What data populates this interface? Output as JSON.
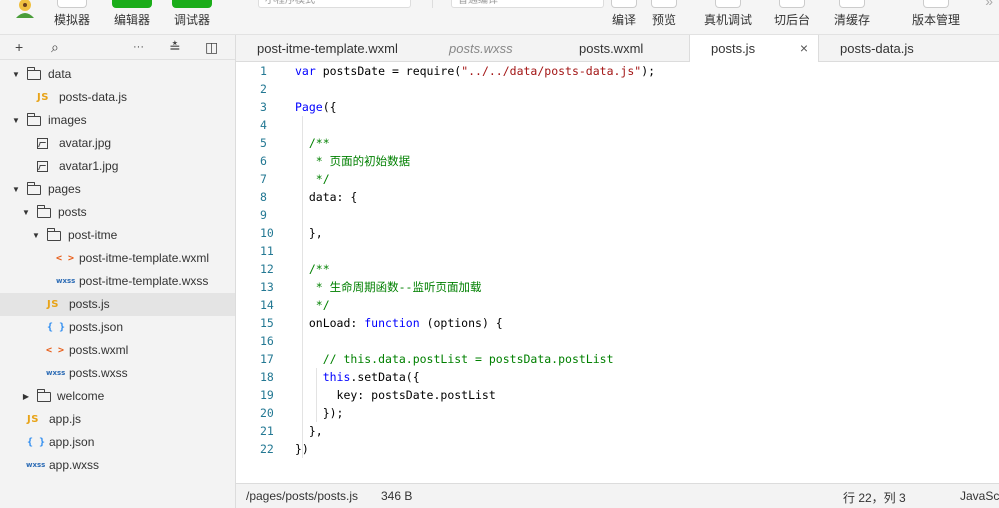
{
  "toolbar": {
    "buttons": [
      {
        "label": "模拟器"
      },
      {
        "label": "编辑器"
      },
      {
        "label": "调试器"
      },
      {
        "label": "编译"
      },
      {
        "label": "预览"
      },
      {
        "label": "真机调试"
      },
      {
        "label": "切后台"
      },
      {
        "label": "清缓存"
      },
      {
        "label": "版本管理"
      }
    ],
    "mode_select": "小程序模式",
    "compile_select": "普通编译"
  },
  "sidebar": {
    "tools": [
      "+",
      "⌕",
      "···",
      "≛",
      "◫"
    ],
    "tree": [
      {
        "label": "data",
        "type": "folder",
        "open": true
      },
      {
        "label": "posts-data.js",
        "type": "js"
      },
      {
        "label": "images",
        "type": "folder",
        "open": true
      },
      {
        "label": "avatar.jpg",
        "type": "image"
      },
      {
        "label": "avatar1.jpg",
        "type": "image"
      },
      {
        "label": "pages",
        "type": "folder",
        "open": true
      },
      {
        "label": "posts",
        "type": "folder",
        "open": true
      },
      {
        "label": "post-itme",
        "type": "folder",
        "open": true
      },
      {
        "label": "post-itme-template.wxml",
        "type": "wxml"
      },
      {
        "label": "post-itme-template.wxss",
        "type": "wxss"
      },
      {
        "label": "posts.js",
        "type": "js"
      },
      {
        "label": "posts.json",
        "type": "json"
      },
      {
        "label": "posts.wxml",
        "type": "wxml"
      },
      {
        "label": "posts.wxss",
        "type": "wxss"
      },
      {
        "label": "welcome",
        "type": "folder",
        "open": false
      },
      {
        "label": "app.js",
        "type": "js"
      },
      {
        "label": "app.json",
        "type": "json"
      },
      {
        "label": "app.wxss",
        "type": "wxss"
      }
    ],
    "icons": {
      "js": "JS",
      "json": "{ }",
      "wxml": "< >",
      "wxss": "wxss"
    }
  },
  "tabs": [
    {
      "label": "post-itme-template.wxml"
    },
    {
      "label": "posts.wxss"
    },
    {
      "label": "posts.wxml"
    },
    {
      "label": "posts.js",
      "close": "×"
    },
    {
      "label": "posts-data.js"
    }
  ],
  "editor": {
    "line_numbers": [
      "1",
      "2",
      "3",
      "4",
      "5",
      "6",
      "7",
      "8",
      "9",
      "10",
      "11",
      "12",
      "13",
      "14",
      "15",
      "16",
      "17",
      "18",
      "19",
      "20",
      "21",
      "22"
    ],
    "lines": [
      [
        {
          "t": "var",
          "c": "k"
        },
        {
          "t": " postsDate = require("
        },
        {
          "t": "\"../../data/posts-data.js\"",
          "c": "s"
        },
        {
          "t": ");"
        }
      ],
      [],
      [
        {
          "t": "Page",
          "c": "k"
        },
        {
          "t": "({"
        }
      ],
      [],
      [
        {
          "t": "  "
        },
        {
          "t": "/**",
          "c": "c"
        }
      ],
      [
        {
          "t": "   "
        },
        {
          "t": "* 页面的初始数据",
          "c": "c"
        }
      ],
      [
        {
          "t": "   "
        },
        {
          "t": "*/",
          "c": "c"
        }
      ],
      [
        {
          "t": "  data: {"
        }
      ],
      [],
      [
        {
          "t": "  },"
        }
      ],
      [],
      [
        {
          "t": "  "
        },
        {
          "t": "/**",
          "c": "c"
        }
      ],
      [
        {
          "t": "   "
        },
        {
          "t": "* 生命周期函数--监听页面加载",
          "c": "c"
        }
      ],
      [
        {
          "t": "   "
        },
        {
          "t": "*/",
          "c": "c"
        }
      ],
      [
        {
          "t": "  onLoad: "
        },
        {
          "t": "function",
          "c": "k"
        },
        {
          "t": " (options) {"
        }
      ],
      [],
      [
        {
          "t": "    "
        },
        {
          "t": "// this.data.postList = postsData.postList",
          "c": "c"
        }
      ],
      [
        {
          "t": "    "
        },
        {
          "t": "this",
          "c": "k"
        },
        {
          "t": ".setData({"
        }
      ],
      [
        {
          "t": "      key: postsDate.postList"
        }
      ],
      [
        {
          "t": "    });"
        }
      ],
      [
        {
          "t": "  },"
        }
      ],
      [
        {
          "t": "})"
        }
      ]
    ]
  },
  "status": {
    "path": "/pages/posts/posts.js",
    "size": "346 B",
    "cursor": "行 22，列 3",
    "language": "JavaScript"
  },
  "colors": {
    "accent": "#1aad19",
    "keyword": "#0000ff",
    "string": "#a31515",
    "comment": "#008000",
    "line_number": "#237893"
  }
}
